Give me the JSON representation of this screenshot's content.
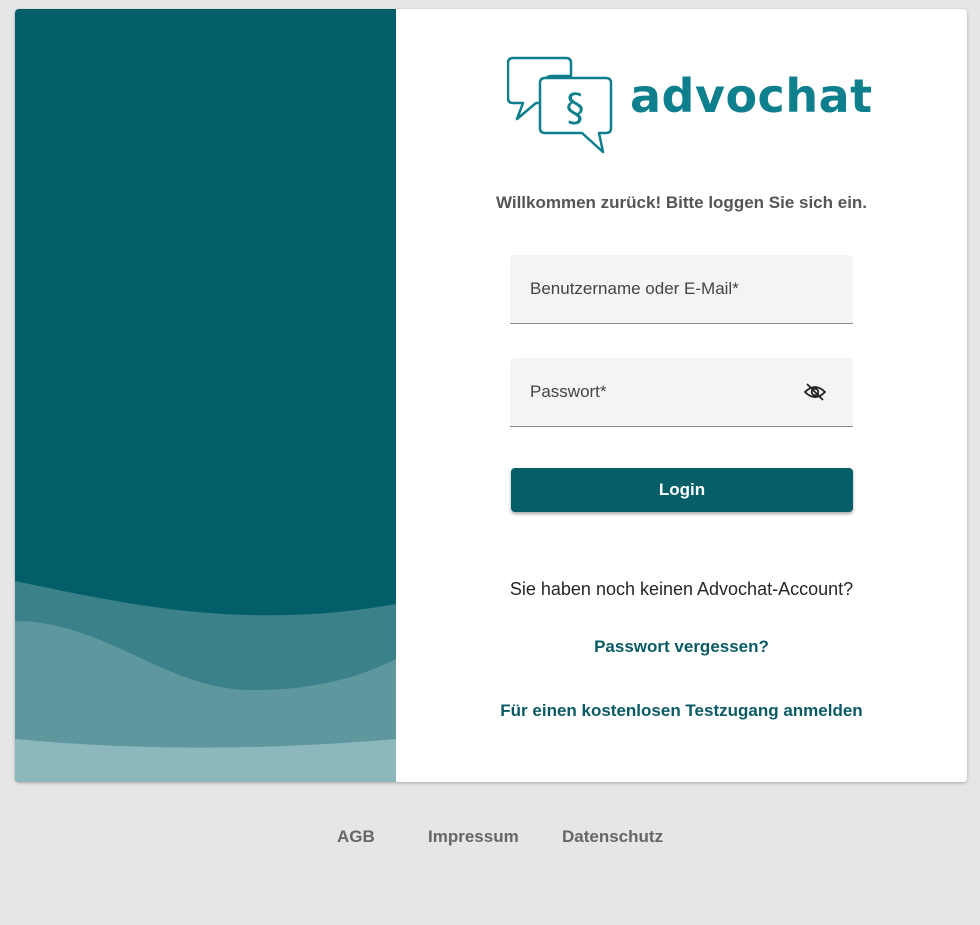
{
  "brand": {
    "name": "advochat",
    "logo_symbol": "§",
    "color": "#0e7f8d"
  },
  "login": {
    "welcome_text": "Willkommen zurück! Bitte loggen Sie sich ein.",
    "username_label": "Benutzername oder E-Mail*",
    "password_label": "Passwort*",
    "password_toggle_icon": "eye-off-icon",
    "login_button": "Login",
    "no_account_text": "Sie haben noch keinen Advochat-Account?",
    "forgot_password_link": "Passwort vergessen?",
    "trial_signup_link": "Für einen kostenlosen Testzugang anmelden"
  },
  "footer": {
    "agb": "AGB",
    "impressum": "Impressum",
    "datenschutz": "Datenschutz"
  },
  "colors": {
    "primary": "#055e68",
    "page_background": "#e6e6e6",
    "field_background": "#f4f4f4"
  }
}
